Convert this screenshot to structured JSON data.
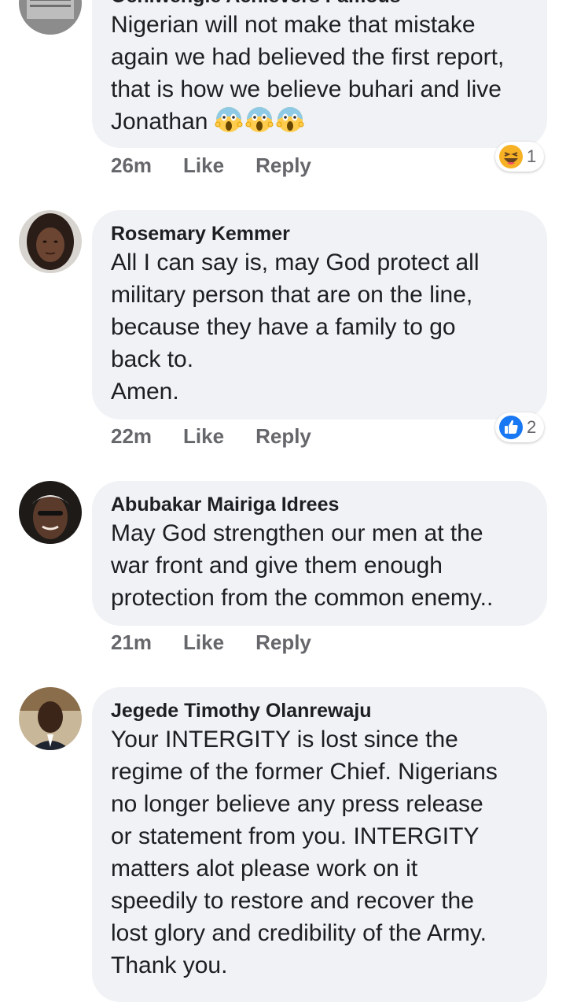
{
  "comments": [
    {
      "author": "Ochiwengie Achievers Famous",
      "text": "Nigerian will not make that mistake\nagain we had believed the first report,\nthat is how we believe buhari and live\nJonathan",
      "emoji": [
        "face-screaming-in-fear",
        "face-screaming-in-fear",
        "face-screaming-in-fear"
      ],
      "time": "26m",
      "like_label": "Like",
      "reply_label": "Reply",
      "reaction": {
        "type": "haha",
        "count": "1"
      }
    },
    {
      "author": "Rosemary Kemmer",
      "text": "All I can say is, may God protect all\nmilitary person that are on the line,\nbecause they have a family to go\nback to.\nAmen.",
      "time": "22m",
      "like_label": "Like",
      "reply_label": "Reply",
      "reaction": {
        "type": "like",
        "count": "2"
      }
    },
    {
      "author": "Abubakar Mairiga Idrees",
      "text": "May God strengthen our men at the\nwar front and give them enough\nprotection from the common enemy..",
      "time": "21m",
      "like_label": "Like",
      "reply_label": "Reply"
    },
    {
      "author": "Jegede Timothy Olanrewaju",
      "text": "Your INTERGITY is lost since the\nregime of the former Chief. Nigerians\nno longer believe any press release\nor statement from you. INTERGITY\nmatters alot please work on it\nspeedily to restore and recover the\nlost glory and credibility of the Army.\nThank you."
    }
  ],
  "colors": {
    "bubble": "#f0f2f5",
    "action_text": "#65676b",
    "like_blue": "#1877f2",
    "haha_yellow": "#f7b125"
  }
}
